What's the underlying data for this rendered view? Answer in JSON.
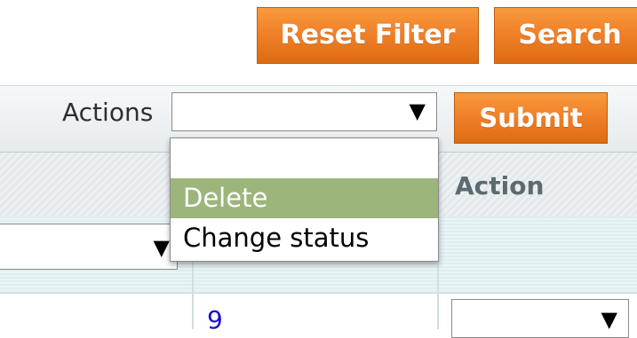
{
  "toolbar": {
    "reset_label": "Reset Filter",
    "search_label": "Search"
  },
  "actions": {
    "label": "Actions",
    "selected_value": "",
    "submit_label": "Submit",
    "dropdown_options": [
      "",
      "Delete",
      "Change status"
    ],
    "highlighted_option": "Delete"
  },
  "grid": {
    "columns": {
      "action": "Action"
    },
    "rows": [
      {
        "id_link": "9",
        "action_value": ""
      }
    ]
  },
  "icons": {
    "select_arrow": "dropdown-arrow-icon"
  },
  "colors": {
    "button_orange": "#f0812a",
    "highlight_green": "#9cb57b",
    "link_blue": "#1a0dcc"
  }
}
